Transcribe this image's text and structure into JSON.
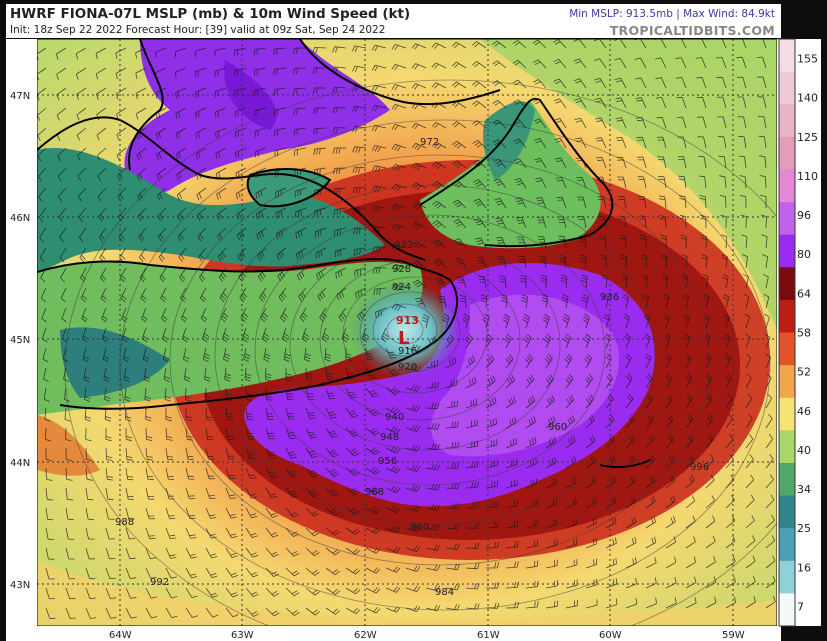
{
  "header": {
    "title": "HWRF FIONA-07L MSLP (mb) & 10m Wind Speed (kt)",
    "init_line": "Init: 18z Sep 22 2022   Forecast Hour: [39]   valid at 09z Sat, Sep 24 2022",
    "stats": "Min MSLP: 913.5mb | Max Wind: 84.9kt",
    "brand": "TROPICALTIDBITS.COM"
  },
  "map": {
    "lat_labels": [
      "47N",
      "46N",
      "45N",
      "44N",
      "43N"
    ],
    "lon_labels": [
      "64W",
      "63W",
      "62W",
      "61W",
      "60W",
      "59W"
    ],
    "center_label": "913",
    "low_marker": "L",
    "isobar_labels": [
      "916",
      "920",
      "924",
      "928",
      "932",
      "936",
      "940",
      "948",
      "956",
      "960",
      "968",
      "972",
      "980",
      "984",
      "988",
      "992",
      "996"
    ]
  },
  "colorbar": {
    "ticks": [
      "155",
      "140",
      "125",
      "110",
      "96",
      "80",
      "64",
      "58",
      "52",
      "46",
      "40",
      "34",
      "25",
      "16",
      "7"
    ],
    "colors": [
      "#f4dde6",
      "#efc9d8",
      "#e9b3c8",
      "#e39db9",
      "#e487d6",
      "#c063ea",
      "#9a2cf0",
      "#7a0c10",
      "#bb1e12",
      "#e4532a",
      "#f2a54a",
      "#f5e472",
      "#a9d66a",
      "#4fa86a",
      "#31848c",
      "#4aa0b4",
      "#90d0d8",
      "#f4f9f9"
    ],
    "unit": "kt"
  }
}
